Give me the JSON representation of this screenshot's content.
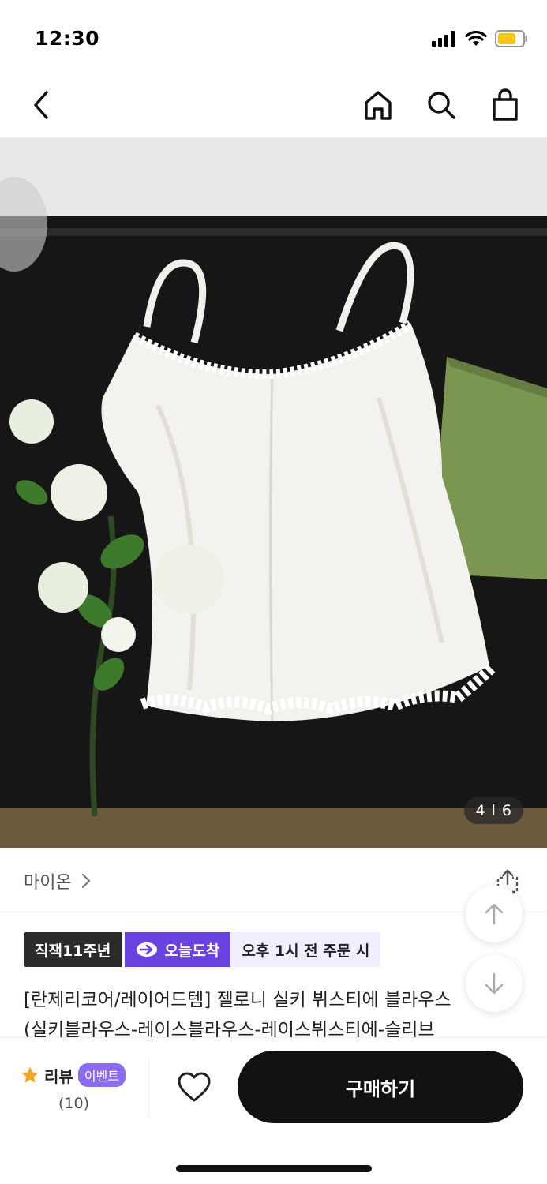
{
  "status": {
    "time": "12:30",
    "signal_icon": "signal-icon",
    "wifi_icon": "wifi-icon",
    "battery_icon": "battery-icon",
    "battery_color": "#f5c518"
  },
  "nav": {
    "back_icon": "chevron-left-icon",
    "home_icon": "home-icon",
    "search_icon": "search-icon",
    "cart_icon": "shopping-bag-icon"
  },
  "gallery": {
    "counter": "4 l 6",
    "current": 4,
    "total": 6
  },
  "brand": {
    "name": "마이온"
  },
  "badges": {
    "anniversary": "직잭11주년",
    "today_delivery": "오늘도착",
    "cutoff": "오후 1시 전 주문 시",
    "accent": "#6a42e0"
  },
  "product": {
    "title_line1": "[란제리코어/레이어드템] 젤로니 실키 뷔스티에 블라우스",
    "title_line2": "(실키블라우스-레이스블라우스-레이스뷔스티에-슬리브"
  },
  "bottom": {
    "review_label": "리뷰",
    "event_label": "이벤트",
    "review_count": "(10)",
    "star_color": "#f5a623",
    "buy_label": "구매하기"
  }
}
